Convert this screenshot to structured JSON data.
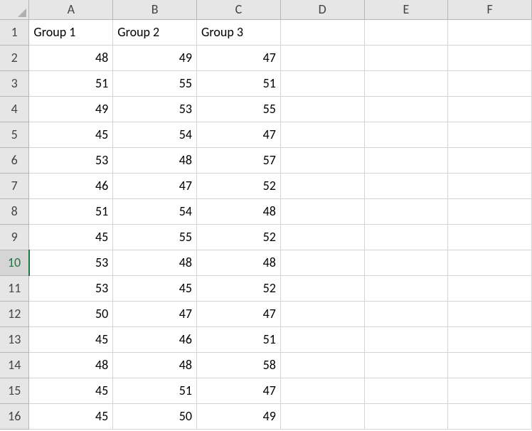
{
  "columns": [
    "A",
    "B",
    "C",
    "D",
    "E",
    "F"
  ],
  "row_numbers": [
    "1",
    "2",
    "3",
    "4",
    "5",
    "6",
    "7",
    "8",
    "9",
    "10",
    "11",
    "12",
    "13",
    "14",
    "15",
    "16"
  ],
  "active_row_index": 9,
  "header_row": [
    "Group 1",
    "Group 2",
    "Group 3",
    "",
    "",
    ""
  ],
  "data_rows": [
    [
      "48",
      "49",
      "47",
      "",
      "",
      ""
    ],
    [
      "51",
      "55",
      "51",
      "",
      "",
      ""
    ],
    [
      "49",
      "53",
      "55",
      "",
      "",
      ""
    ],
    [
      "45",
      "54",
      "47",
      "",
      "",
      ""
    ],
    [
      "53",
      "48",
      "57",
      "",
      "",
      ""
    ],
    [
      "46",
      "47",
      "52",
      "",
      "",
      ""
    ],
    [
      "51",
      "54",
      "48",
      "",
      "",
      ""
    ],
    [
      "45",
      "55",
      "52",
      "",
      "",
      ""
    ],
    [
      "53",
      "48",
      "48",
      "",
      "",
      ""
    ],
    [
      "53",
      "45",
      "52",
      "",
      "",
      ""
    ],
    [
      "50",
      "47",
      "47",
      "",
      "",
      ""
    ],
    [
      "45",
      "46",
      "51",
      "",
      "",
      ""
    ],
    [
      "48",
      "48",
      "58",
      "",
      "",
      ""
    ],
    [
      "45",
      "51",
      "47",
      "",
      "",
      ""
    ],
    [
      "45",
      "50",
      "49",
      "",
      "",
      ""
    ]
  ],
  "chart_data": {
    "type": "table",
    "title": "",
    "columns": [
      "Group 1",
      "Group 2",
      "Group 3"
    ],
    "rows": [
      [
        48,
        49,
        47
      ],
      [
        51,
        55,
        51
      ],
      [
        49,
        53,
        55
      ],
      [
        45,
        54,
        47
      ],
      [
        53,
        48,
        57
      ],
      [
        46,
        47,
        52
      ],
      [
        51,
        54,
        48
      ],
      [
        45,
        55,
        52
      ],
      [
        53,
        48,
        48
      ],
      [
        53,
        45,
        52
      ],
      [
        50,
        47,
        47
      ],
      [
        45,
        46,
        51
      ],
      [
        48,
        48,
        58
      ],
      [
        45,
        51,
        47
      ],
      [
        45,
        50,
        49
      ]
    ]
  }
}
